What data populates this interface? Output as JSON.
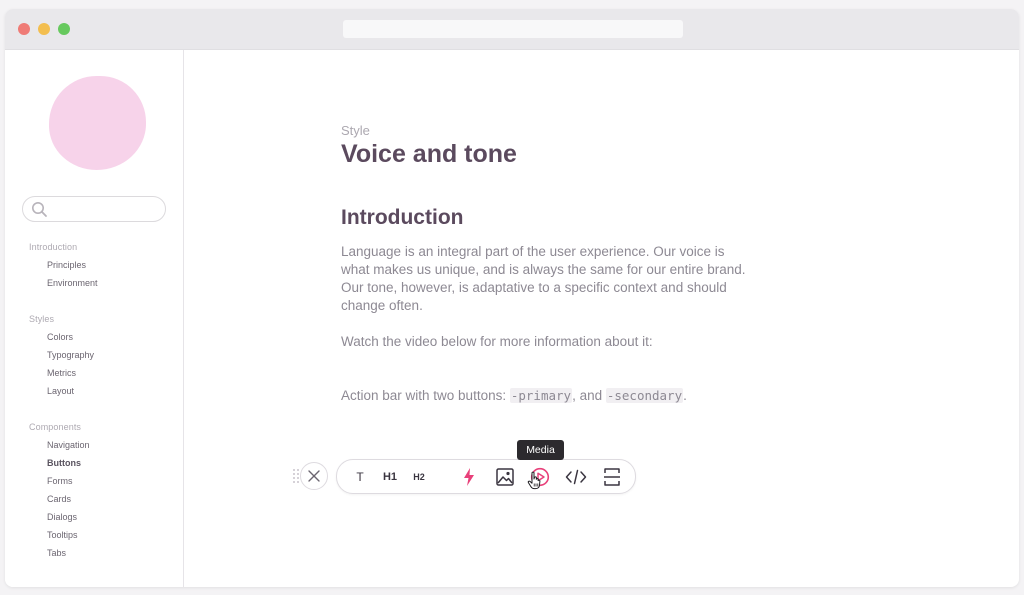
{
  "sidebar": {
    "search": {
      "placeholder": ""
    },
    "sections": [
      {
        "header": "Introduction",
        "items": [
          "Principles",
          "Environment"
        ]
      },
      {
        "header": "Styles",
        "items": [
          "Colors",
          "Typography",
          "Metrics",
          "Layout"
        ]
      },
      {
        "header": "Components",
        "items": [
          "Navigation",
          "Buttons",
          "Forms",
          "Cards",
          "Dialogs",
          "Tooltips",
          "Tabs"
        ]
      }
    ],
    "active_item": "Buttons"
  },
  "main": {
    "kicker": "Style",
    "title": "Voice and tone",
    "section_title": "Introduction",
    "paragraph1": "Language is an integral part of the user experience. Our voice is what makes us unique, and is always the same for our entire brand. Our tone, however, is adaptative to a specific context and should change often.",
    "paragraph2": "Watch the video below for more information about it:",
    "paragraph3": {
      "prefix": "Action bar with two buttons: ",
      "code1": "-primary",
      "middle": ", and ",
      "code2": "-secondary",
      "suffix": "."
    }
  },
  "toolbar": {
    "text_label": "T",
    "h1_label": "H1",
    "h2_label": "H2",
    "tooltip": "Media",
    "icons": [
      "drag-handle-icon",
      "close-icon",
      "bolt-icon",
      "image-icon",
      "media-play-icon",
      "code-icon",
      "divider-icon"
    ]
  },
  "colors": {
    "accent": "#e8407a",
    "heading": "#5b4a5e",
    "logo": "#f7d3ea"
  }
}
